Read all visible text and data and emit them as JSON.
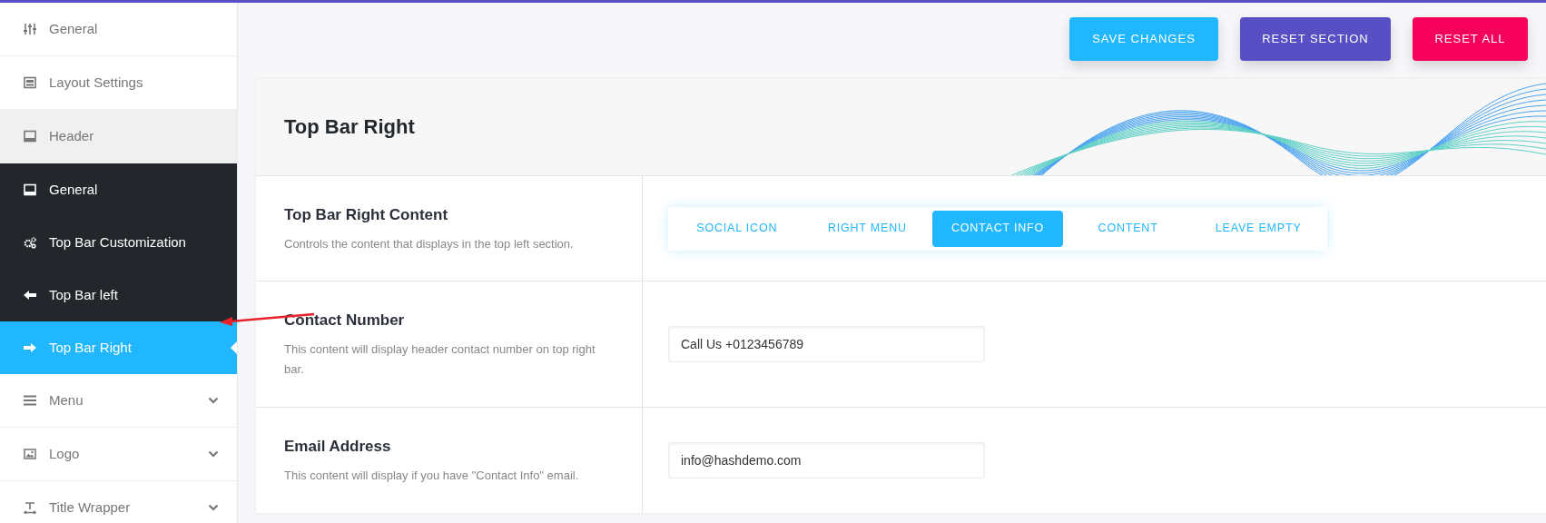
{
  "toolbar": {
    "buttons": [
      {
        "label": "SAVE CHANGES",
        "kind": "save"
      },
      {
        "label": "RESET SECTION",
        "kind": "reset-section"
      },
      {
        "label": "RESET ALL",
        "kind": "reset-all"
      }
    ]
  },
  "sidebar": {
    "items": [
      {
        "label": "General",
        "selected": false
      },
      {
        "label": "Layout Settings",
        "selected": false
      },
      {
        "label": "Header",
        "selected": false,
        "expanded": true,
        "children": [
          {
            "label": "General",
            "selected": false
          },
          {
            "label": "Top Bar Customization",
            "selected": false
          },
          {
            "label": "Top Bar left",
            "selected": false
          },
          {
            "label": "Top Bar Right",
            "selected": true
          }
        ]
      },
      {
        "label": "Menu",
        "selected": false,
        "expanded": false
      },
      {
        "label": "Logo",
        "selected": false,
        "expanded": false
      },
      {
        "label": "Title Wrapper",
        "selected": false,
        "expanded": false
      }
    ]
  },
  "panel": {
    "title": "Top Bar Right",
    "rows": [
      {
        "kind": "choice",
        "label": "Top Bar Right Content",
        "description": "Controls the content that displays in the top left section.",
        "options": [
          {
            "label": "SOCIAL ICON",
            "selected": false
          },
          {
            "label": "RIGHT MENU",
            "selected": false
          },
          {
            "label": "CONTACT INFO",
            "selected": true
          },
          {
            "label": "CONTENT",
            "selected": false
          },
          {
            "label": "LEAVE EMPTY",
            "selected": false
          }
        ]
      },
      {
        "kind": "text",
        "label": "Contact Number",
        "description": "This content will display header contact number on top right bar.",
        "value": "Call Us +0123456789"
      },
      {
        "kind": "text",
        "label": "Email Address",
        "description": "This content will display if you have \"Contact Info\" email.",
        "value": "info@hashdemo.com"
      }
    ]
  }
}
